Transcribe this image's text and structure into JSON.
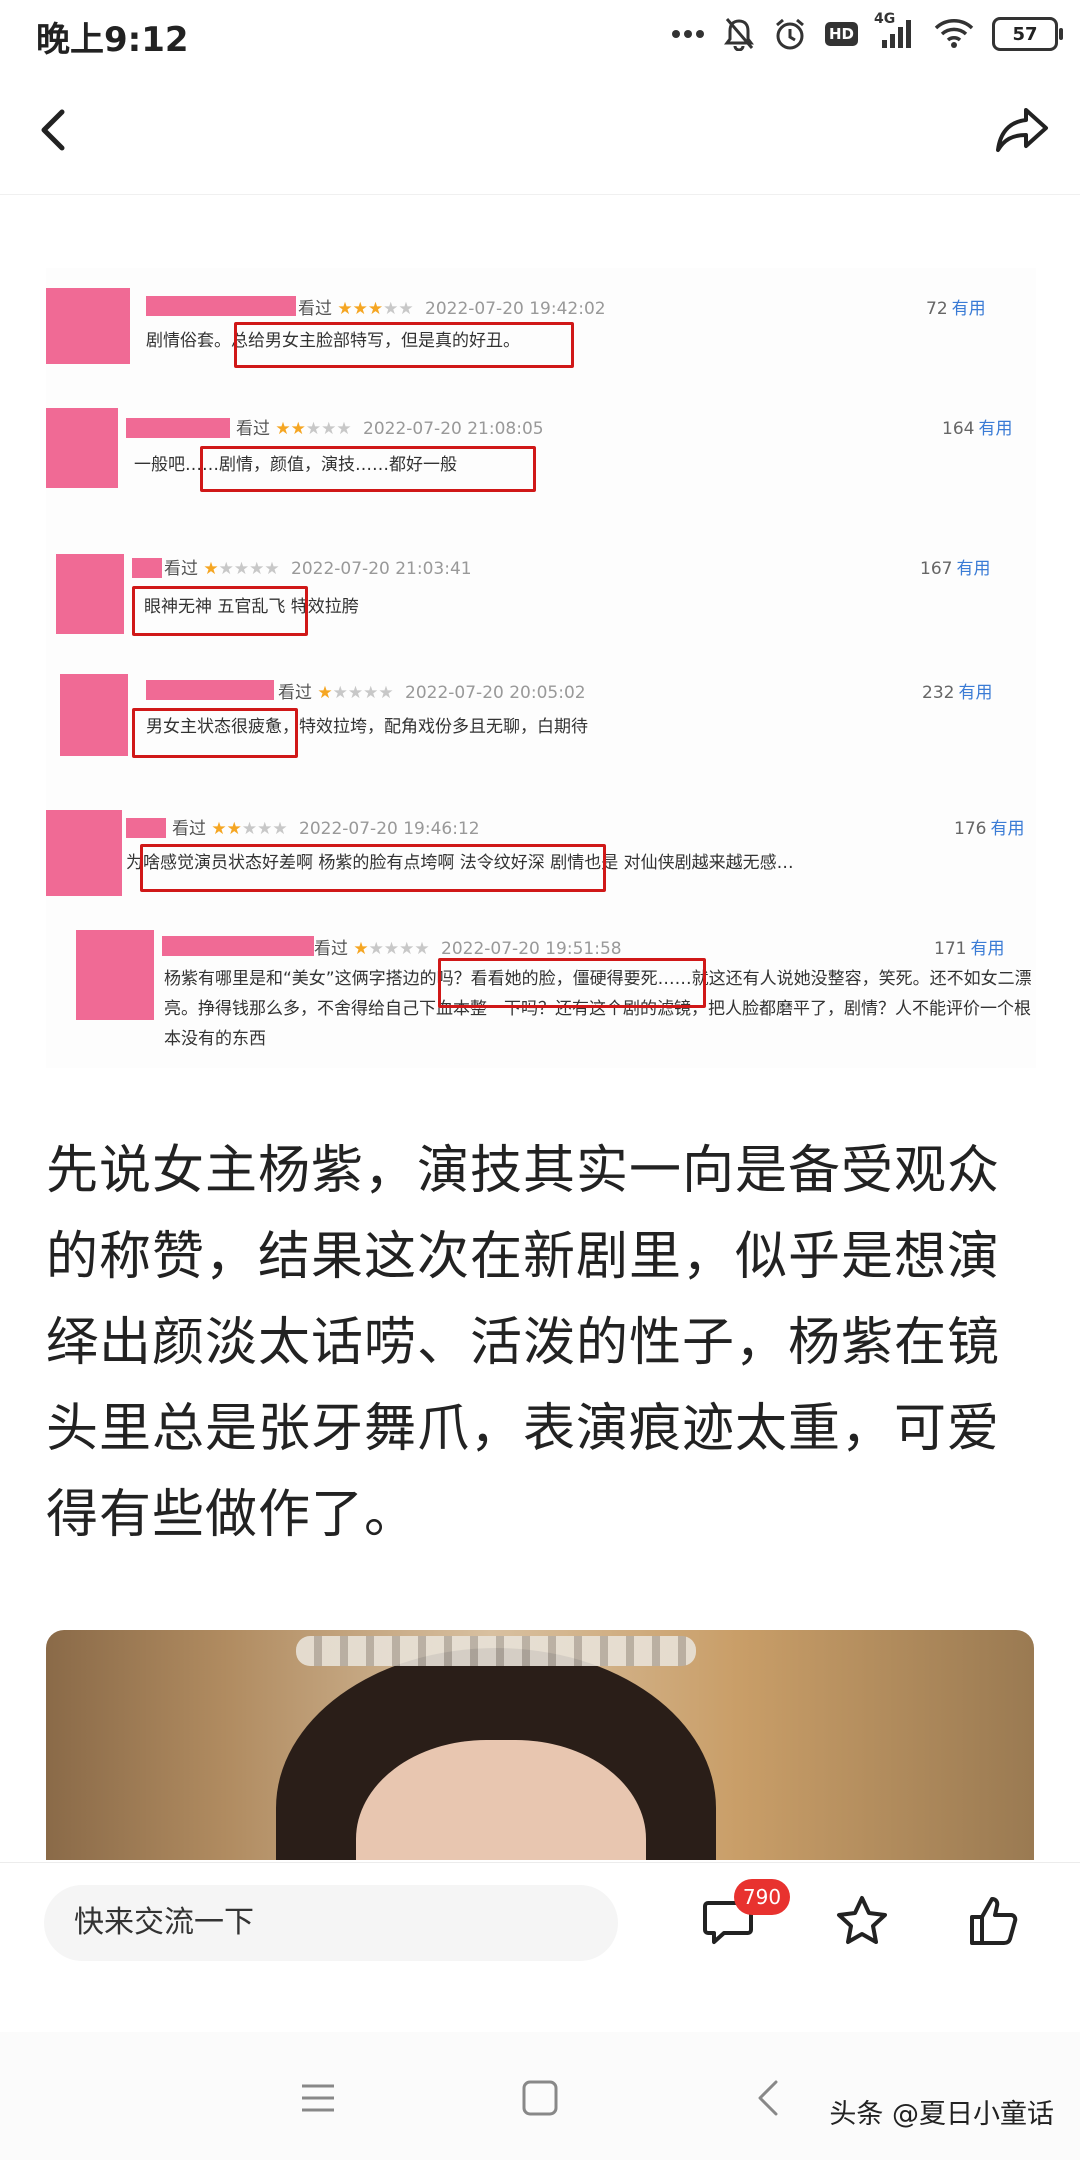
{
  "status_bar": {
    "time": "晚上9:12",
    "icons": [
      "more-dots-icon",
      "mute-bell-icon",
      "alarm-icon",
      "hd-icon",
      "signal-icon",
      "wifi-icon",
      "battery-icon"
    ],
    "hd_label": "HD",
    "network_label": "4G",
    "battery": "57"
  },
  "nav": {
    "back_icon": "chevron-left-icon",
    "share_icon": "share-arrow-icon"
  },
  "reviews_image": {
    "reviews": [
      {
        "status": "看过",
        "date": "2022-07-20 19:42:02",
        "useful_count": "72",
        "useful_label": "有用",
        "text": "剧情俗套。总给男女主脸部特写，但是真的好丑。",
        "stars_on": 3,
        "stars_off": 2
      },
      {
        "status": "看过",
        "date": "2022-07-20 21:08:05",
        "useful_count": "164",
        "useful_label": "有用",
        "text": "一般吧……剧情，颜值，演技……都好一般",
        "stars_on": 2,
        "stars_off": 3
      },
      {
        "status": "看过",
        "date": "2022-07-20 21:03:41",
        "useful_count": "167",
        "useful_label": "有用",
        "text": "眼神无神 五官乱飞 特效拉胯",
        "stars_on": 1,
        "stars_off": 4
      },
      {
        "status": "看过",
        "date": "2022-07-20 20:05:02",
        "useful_count": "232",
        "useful_label": "有用",
        "text": "男女主状态很疲惫，特效拉垮，配角戏份多且无聊，白期待",
        "stars_on": 1,
        "stars_off": 4
      },
      {
        "status": "看过",
        "date": "2022-07-20 19:46:12",
        "useful_count": "176",
        "useful_label": "有用",
        "text": "为啥感觉演员状态好差啊 杨紫的脸有点垮啊 法令纹好深 剧情也是 对仙侠剧越来越无感…",
        "stars_on": 2,
        "stars_off": 3
      },
      {
        "status": "看过",
        "date": "2022-07-20 19:51:58",
        "useful_count": "171",
        "useful_label": "有用",
        "text": "杨紫有哪里是和“美女”这俩字搭边的吗？看看她的脸，僵硬得要死……就这还有人说她没整容，笑死。还不如女二漂亮。挣得钱那么多，不舍得给自己下血本整一下吗？还有这个剧的滤镜，把人脸都磨平了，剧情？人不能评价一个根本没有的东西",
        "stars_on": 1,
        "stars_off": 4
      }
    ]
  },
  "article": {
    "paragraph": "先说女主杨紫，演技其实一向是备受观众的称赞，结果这次在新剧里，似乎是想演绎出颜淡太话唠、活泼的性子，杨紫在镜头里总是张牙舞爪，表演痕迹太重，可爱得有些做作了。"
  },
  "bottom_bar": {
    "comment_placeholder": "快来交流一下",
    "comment_count": "790",
    "icons": [
      "comment-icon",
      "star-icon",
      "thumbs-up-icon"
    ]
  },
  "system_nav": {
    "icons": [
      "menu-icon",
      "home-square-icon",
      "back-chevron-icon"
    ],
    "watermark": "头条 @夏日小童话"
  },
  "colors": {
    "accent_red": "#e8322f",
    "highlight_box": "#d01818",
    "redaction_pink": "#f06a95",
    "useful_blue": "#3a7bd5",
    "star_gold": "#f5a623"
  }
}
